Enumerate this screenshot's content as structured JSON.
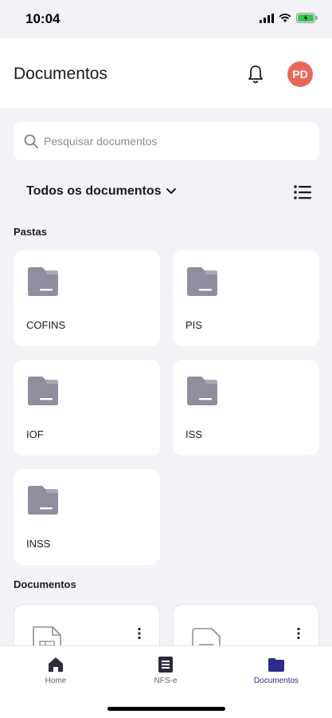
{
  "status_bar": {
    "time": "10:04"
  },
  "header": {
    "title": "Documentos",
    "avatar_initials": "PD"
  },
  "search": {
    "placeholder": "Pesquisar documentos",
    "value": ""
  },
  "filter": {
    "label": "Todos os documentos"
  },
  "sections": {
    "folders_title": "Pastas",
    "documents_title": "Documentos"
  },
  "folders": [
    {
      "label": "COFINS"
    },
    {
      "label": "PIS"
    },
    {
      "label": "IOF"
    },
    {
      "label": "ISS"
    },
    {
      "label": "INSS"
    }
  ],
  "tab_bar": {
    "tabs": [
      {
        "label": "Home",
        "icon": "home-icon"
      },
      {
        "label": "NFS-e",
        "icon": "receipt-icon"
      },
      {
        "label": "Documentos",
        "icon": "folder-icon",
        "active": true
      }
    ]
  },
  "colors": {
    "accent": "#2d2a8f",
    "avatar": "#e8675b",
    "folder": "#8e8e9e",
    "background": "#f2f2f7"
  }
}
